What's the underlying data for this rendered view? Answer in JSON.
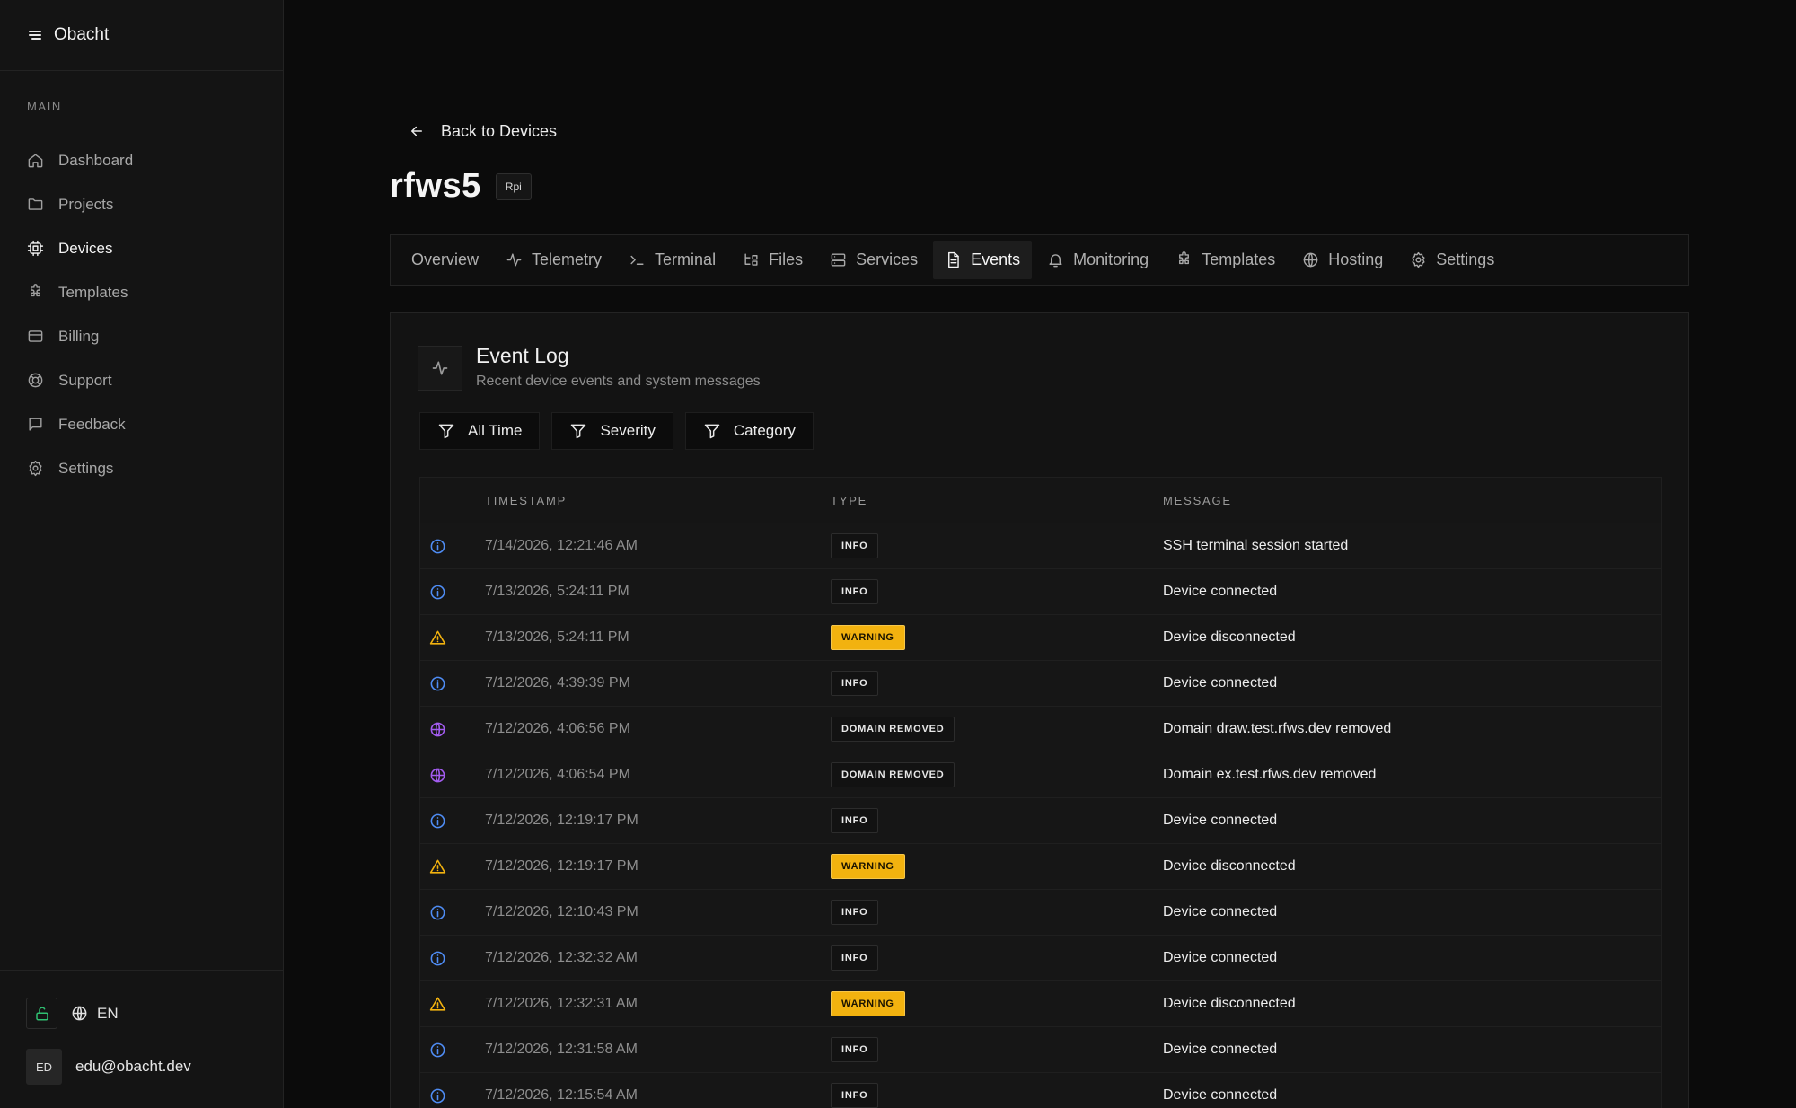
{
  "app": {
    "name": "Obacht"
  },
  "sidebar": {
    "section_label": "MAIN",
    "items": [
      {
        "label": "Dashboard",
        "icon": "home-icon",
        "active": false
      },
      {
        "label": "Projects",
        "icon": "folder-icon",
        "active": false
      },
      {
        "label": "Devices",
        "icon": "cpu-icon",
        "active": true
      },
      {
        "label": "Templates",
        "icon": "puzzle-icon",
        "active": false
      },
      {
        "label": "Billing",
        "icon": "credit-card-icon",
        "active": false
      },
      {
        "label": "Support",
        "icon": "lifebuoy-icon",
        "active": false
      },
      {
        "label": "Feedback",
        "icon": "message-square-icon",
        "active": false
      },
      {
        "label": "Settings",
        "icon": "gear-icon",
        "active": false
      }
    ],
    "footer": {
      "language": "EN",
      "avatar_initials": "ED",
      "user_email": "edu@obacht.dev"
    }
  },
  "header": {
    "back_label": "Back to Devices",
    "device_name": "rfws5",
    "device_badge": "Rpi"
  },
  "tabs": [
    {
      "label": "Overview",
      "icon": "",
      "active": false
    },
    {
      "label": "Telemetry",
      "icon": "activity-icon",
      "active": false
    },
    {
      "label": "Terminal",
      "icon": "terminal-icon",
      "active": false
    },
    {
      "label": "Files",
      "icon": "files-icon",
      "active": false
    },
    {
      "label": "Services",
      "icon": "server-icon",
      "active": false
    },
    {
      "label": "Events",
      "icon": "file-text-icon",
      "active": true
    },
    {
      "label": "Monitoring",
      "icon": "bell-icon",
      "active": false
    },
    {
      "label": "Templates",
      "icon": "puzzle-icon",
      "active": false
    },
    {
      "label": "Hosting",
      "icon": "globe-icon",
      "active": false
    },
    {
      "label": "Settings",
      "icon": "gear-icon",
      "active": false
    }
  ],
  "event_log": {
    "title": "Event Log",
    "subtitle": "Recent device events and system messages",
    "filters": [
      "All Time",
      "Severity",
      "Category"
    ],
    "columns": {
      "timestamp": "TIMESTAMP",
      "type": "TYPE",
      "message": "MESSAGE"
    },
    "rows": [
      {
        "kind": "info",
        "timestamp": "7/14/2026, 12:21:46 AM",
        "type": "INFO",
        "message": "SSH terminal session started"
      },
      {
        "kind": "info",
        "timestamp": "7/13/2026, 5:24:11 PM",
        "type": "INFO",
        "message": "Device connected"
      },
      {
        "kind": "warning",
        "timestamp": "7/13/2026, 5:24:11 PM",
        "type": "WARNING",
        "message": "Device disconnected"
      },
      {
        "kind": "info",
        "timestamp": "7/12/2026, 4:39:39 PM",
        "type": "INFO",
        "message": "Device connected"
      },
      {
        "kind": "domain",
        "timestamp": "7/12/2026, 4:06:56 PM",
        "type": "DOMAIN REMOVED",
        "message": "Domain draw.test.rfws.dev removed"
      },
      {
        "kind": "domain",
        "timestamp": "7/12/2026, 4:06:54 PM",
        "type": "DOMAIN REMOVED",
        "message": "Domain ex.test.rfws.dev removed"
      },
      {
        "kind": "info",
        "timestamp": "7/12/2026, 12:19:17 PM",
        "type": "INFO",
        "message": "Device connected"
      },
      {
        "kind": "warning",
        "timestamp": "7/12/2026, 12:19:17 PM",
        "type": "WARNING",
        "message": "Device disconnected"
      },
      {
        "kind": "info",
        "timestamp": "7/12/2026, 12:10:43 PM",
        "type": "INFO",
        "message": "Device connected"
      },
      {
        "kind": "info",
        "timestamp": "7/12/2026, 12:32:32 AM",
        "type": "INFO",
        "message": "Device connected"
      },
      {
        "kind": "warning",
        "timestamp": "7/12/2026, 12:32:31 AM",
        "type": "WARNING",
        "message": "Device disconnected"
      },
      {
        "kind": "info",
        "timestamp": "7/12/2026, 12:31:58 AM",
        "type": "INFO",
        "message": "Device connected"
      },
      {
        "kind": "info",
        "timestamp": "7/12/2026, 12:15:54 AM",
        "type": "INFO",
        "message": "Device connected"
      }
    ]
  },
  "colors": {
    "info": "#4f8df5",
    "warning": "#f2b20f",
    "domain": "#a35cf0",
    "lock": "#2fbf71"
  }
}
